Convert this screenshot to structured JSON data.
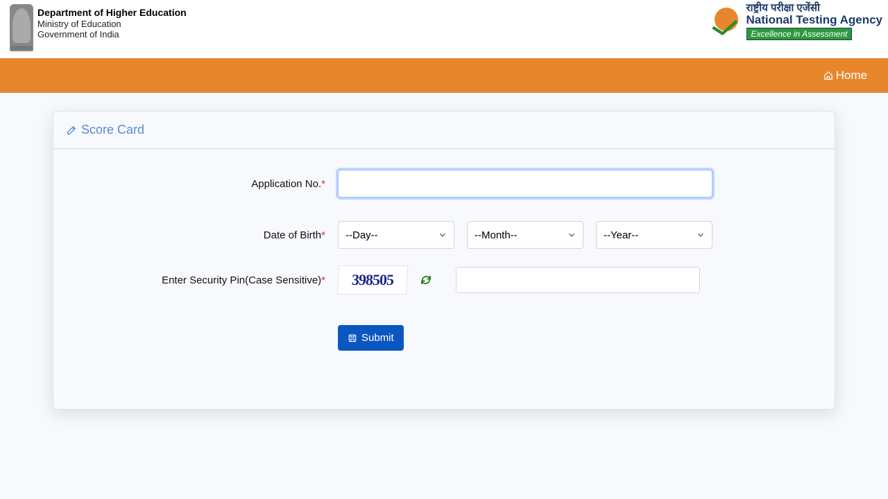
{
  "header": {
    "dept_line1": "Department of Higher Education",
    "dept_line2": "Ministry of Education",
    "dept_line3": "Government of India",
    "nta_hi": "राष्ट्रीय परीक्षा एजेंसी",
    "nta_en": "National Testing Agency",
    "nta_tag": "Excellence in Assessment"
  },
  "nav": {
    "home": "Home"
  },
  "card": {
    "title": "Score Card"
  },
  "form": {
    "app_no_label": "Application No.",
    "dob_label": "Date of Birth",
    "pin_label": "Enter Security Pin(Case Sensitive)",
    "day_placeholder": "--Day--",
    "month_placeholder": "--Month--",
    "year_placeholder": "--Year--",
    "captcha_text": "398505",
    "submit_label": "Submit"
  }
}
